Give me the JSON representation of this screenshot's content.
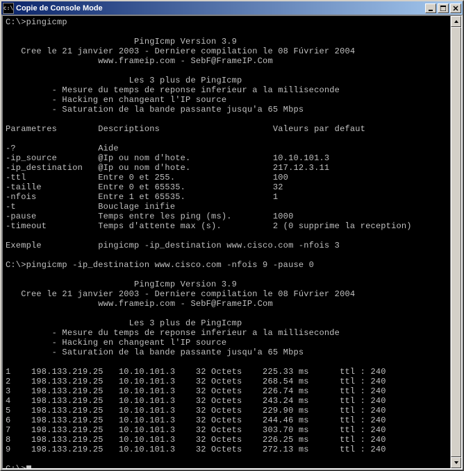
{
  "window": {
    "title": "Copie de Console Mode",
    "icon_glyph": "c:\\"
  },
  "console": {
    "prompt": "C:\\>",
    "cmd1": "pingicmp",
    "banner": {
      "title": "PingIcmp Version 3.9",
      "line2": "Cree le 21 janvier 2003 - Derniere compilation le 08 Fúvrier 2004",
      "line3": "www.frameip.com - SebF@FrameIP.Com"
    },
    "features": {
      "title": "Les 3 plus de PingIcmp",
      "l1": "- Mesure du temps de reponse inferieur a la milliseconde",
      "l2": "- Hacking en changeant l'IP source",
      "l3": "- Saturation de la bande passante jusqu'a 65 Mbps"
    },
    "params_header": {
      "c1": "Parametres",
      "c2": "Descriptions",
      "c3": "Valeurs par defaut"
    },
    "params": [
      {
        "name": "-?",
        "desc": "Aide",
        "val": ""
      },
      {
        "name": "-ip_source",
        "desc": "@Ip ou nom d'hote.",
        "val": "10.10.101.3"
      },
      {
        "name": "-ip_destination",
        "desc": "@Ip ou nom d'hote.",
        "val": "217.12.3.11"
      },
      {
        "name": "-ttl",
        "desc": "Entre 0 et 255.",
        "val": "100"
      },
      {
        "name": "-taille",
        "desc": "Entre 0 et 65535.",
        "val": "32"
      },
      {
        "name": "-nfois",
        "desc": "Entre 1 et 65535.",
        "val": "1"
      },
      {
        "name": "-t",
        "desc": "Bouclage inifie",
        "val": ""
      },
      {
        "name": "-pause",
        "desc": "Temps entre les ping (ms).",
        "val": "1000"
      },
      {
        "name": "-timeout",
        "desc": "Temps d'attente max (s).",
        "val": "2 (0 supprime la reception)"
      }
    ],
    "example": {
      "label": "Exemple",
      "cmd": "pingicmp -ip_destination www.cisco.com -nfois 3"
    },
    "cmd2": "pingicmp -ip_destination www.cisco.com -nfois 9 -pause 0",
    "results": [
      {
        "n": "1",
        "dst": "198.133.219.25",
        "src": "10.10.101.3",
        "size": "32 Octets",
        "time": "225.33 ms",
        "ttl": "ttl : 240"
      },
      {
        "n": "2",
        "dst": "198.133.219.25",
        "src": "10.10.101.3",
        "size": "32 Octets",
        "time": "268.54 ms",
        "ttl": "ttl : 240"
      },
      {
        "n": "3",
        "dst": "198.133.219.25",
        "src": "10.10.101.3",
        "size": "32 Octets",
        "time": "226.74 ms",
        "ttl": "ttl : 240"
      },
      {
        "n": "4",
        "dst": "198.133.219.25",
        "src": "10.10.101.3",
        "size": "32 Octets",
        "time": "243.24 ms",
        "ttl": "ttl : 240"
      },
      {
        "n": "5",
        "dst": "198.133.219.25",
        "src": "10.10.101.3",
        "size": "32 Octets",
        "time": "229.90 ms",
        "ttl": "ttl : 240"
      },
      {
        "n": "6",
        "dst": "198.133.219.25",
        "src": "10.10.101.3",
        "size": "32 Octets",
        "time": "244.46 ms",
        "ttl": "ttl : 240"
      },
      {
        "n": "7",
        "dst": "198.133.219.25",
        "src": "10.10.101.3",
        "size": "32 Octets",
        "time": "303.70 ms",
        "ttl": "ttl : 240"
      },
      {
        "n": "8",
        "dst": "198.133.219.25",
        "src": "10.10.101.3",
        "size": "32 Octets",
        "time": "226.25 ms",
        "ttl": "ttl : 240"
      },
      {
        "n": "9",
        "dst": "198.133.219.25",
        "src": "10.10.101.3",
        "size": "32 Octets",
        "time": "272.13 ms",
        "ttl": "ttl : 240"
      }
    ]
  }
}
